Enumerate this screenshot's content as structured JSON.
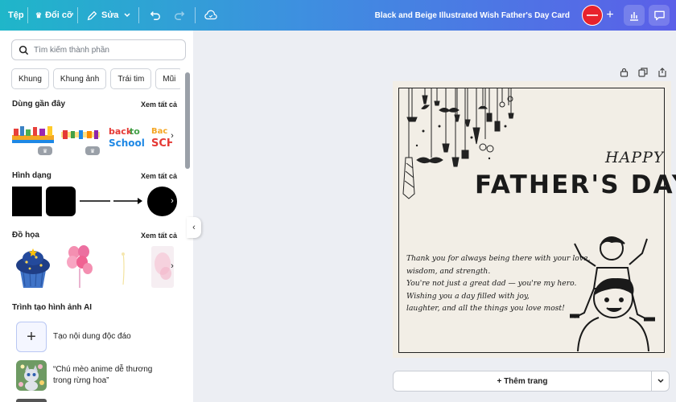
{
  "topbar": {
    "file_label": "Tệp",
    "resize_label": "Đổi cỡ",
    "edit_label": "Sửa",
    "design_title": "Black and Beige Illustrated Wish Father's Day Card",
    "add_icon": "plus-icon",
    "analytics_icon": "bar-chart-icon",
    "comment_icon": "comment-icon"
  },
  "sidebar": {
    "search_placeholder": "Tìm kiếm thành phần",
    "chips": [
      "Khung",
      "Khung ảnh",
      "Trái tim",
      "Mũi"
    ],
    "recent": {
      "title": "Dùng gần đây",
      "see_all": "Xem tất cả",
      "items": [
        "back to school sticker",
        "back to school banner",
        "back to school",
        "Back to SCHOOL"
      ]
    },
    "shapes": {
      "title": "Hình dạng",
      "see_all": "Xem tất cả"
    },
    "graphics": {
      "title": "Đồ họa",
      "see_all": "Xem tất cả"
    },
    "ai": {
      "title": "Trình tạo hình ảnh AI",
      "create_label": "Tạo nội dung độc đáo",
      "sample_prompt": "“Chú mèo anime dễ thương trong rừng hoa”"
    }
  },
  "card": {
    "happy": "HAPPY",
    "heading": "FATHER'S DAY",
    "message_lines": [
      "Thank you for always being there with your love,",
      "wisdom, and strength.",
      "You're not just a great dad — you're my hero.",
      "Wishing you a day filled with joy,",
      "laughter, and all the things you love most!"
    ]
  },
  "canvas": {
    "add_page_label": "+ Thêm trang"
  },
  "colors": {
    "topbar_start": "#1fb6c9",
    "topbar_end": "#5b5fe8",
    "card_bg": "#f2eee6",
    "avatar": "#e8222c"
  }
}
